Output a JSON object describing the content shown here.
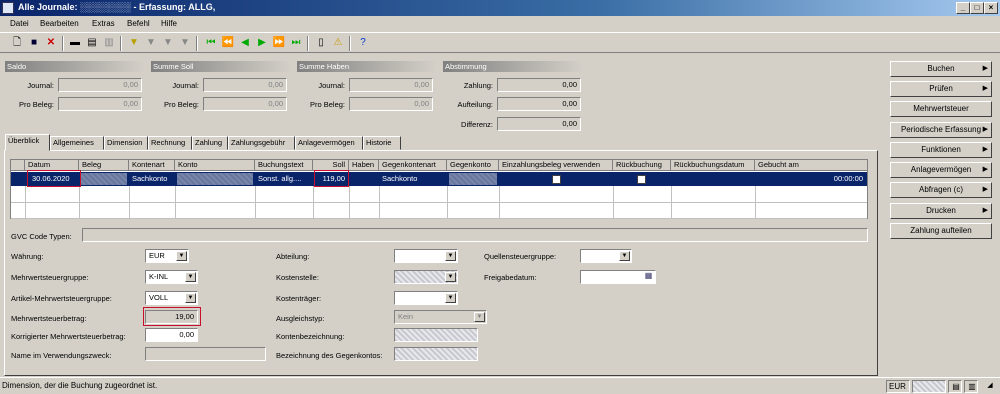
{
  "window": {
    "title": "Alle Journale: ░░░░░░░░ - Erfassung: ALLG,",
    "min": "_",
    "max": "□",
    "close": "×"
  },
  "menu": [
    "Datei",
    "Bearbeiten",
    "Extras",
    "Befehl",
    "Hilfe"
  ],
  "groups": {
    "saldo": "Saldo",
    "soll": "Summe Soll",
    "haben": "Summe Haben",
    "abstimmung": "Abstimmung"
  },
  "saldo": {
    "journal_label": "Journal:",
    "journal_value": "0,00",
    "probeleg_label": "Pro Beleg:",
    "probeleg_value": "0,00"
  },
  "soll": {
    "journal_label": "Journal:",
    "journal_value": "0,00",
    "probeleg_label": "Pro Beleg:",
    "probeleg_value": "0,00"
  },
  "haben": {
    "journal_label": "Journal:",
    "journal_value": "0,00",
    "probeleg_label": "Pro Beleg:",
    "probeleg_value": "0,00"
  },
  "abstimmung": {
    "zahlung_label": "Zahlung:",
    "zahlung_value": "0,00",
    "aufteilung_label": "Aufteilung:",
    "aufteilung_value": "0,00",
    "differenz_label": "Differenz:",
    "differenz_value": "0,00"
  },
  "tabs": [
    "Überblick",
    "Allgemeines",
    "Dimension",
    "Rechnung",
    "Zahlung",
    "Zahlungsgebühr",
    "Anlagevermögen",
    "Historie"
  ],
  "grid": {
    "columns": [
      "Datum",
      "Beleg",
      "Kontenart",
      "Konto",
      "Buchungstext",
      "Soll",
      "Haben",
      "Gegenkontenart",
      "Gegenkonto",
      "Einzahlungsbeleg verwenden",
      "Rückbuchung",
      "Rückbuchungsdatum",
      "Gebucht am"
    ],
    "row": {
      "datum": "30.06.2020",
      "kontenart": "Sachkonto",
      "buchungstext": "Sonst. allg....",
      "soll": "119,00",
      "gegenkontenart": "Sachkonto",
      "gebucht": "00:00:00"
    }
  },
  "gvc": {
    "label": "GVC Code Typen:"
  },
  "form": {
    "waehrung_label": "Währung:",
    "waehrung_value": "EUR",
    "mwstgruppe_label": "Mehrwertsteuergruppe:",
    "mwstgruppe_value": "K-INL",
    "artmwst_label": "Artikel-Mehrwertsteuergruppe:",
    "artmwst_value": "VOLL",
    "mwstbetrag_label": "Mehrwertsteuerbetrag:",
    "mwstbetrag_value": "19,00",
    "korr_label": "Korrigierter Mehrwertsteuerbetrag:",
    "korr_value": "0,00",
    "name_label": "Name im Verwendungszweck:",
    "abteilung_label": "Abteilung:",
    "kostenstelle_label": "Kostenstelle:",
    "kostentraeger_label": "Kostenträger:",
    "ausgleich_label": "Ausgleichstyp:",
    "ausgleich_value": "Kein",
    "kontenbez_label": "Kontenbezeichnung:",
    "gegenbez_label": "Bezeichnung des Gegenkontos:",
    "quellen_label": "Quellensteuergruppe:",
    "freigabe_label": "Freigabedatum:"
  },
  "buttons": [
    {
      "label": "Buchen",
      "arrow": "▶"
    },
    {
      "label": "Prüfen",
      "arrow": "▶"
    },
    {
      "label": "Mehrwertsteuer",
      "arrow": ""
    },
    {
      "label": "Periodische Erfassung",
      "arrow": "▶"
    },
    {
      "label": "Funktionen",
      "arrow": "▶"
    },
    {
      "label": "Anlagevermögen",
      "arrow": "▶"
    },
    {
      "label": "Abfragen (c)",
      "arrow": "▶"
    },
    {
      "label": "Drucken",
      "arrow": "▶"
    },
    {
      "label": "Zahlung aufteilen",
      "arrow": ""
    }
  ],
  "status": {
    "text": "Dimension, der die Buchung zugeordnet ist.",
    "currency": "EUR"
  },
  "colors": {
    "selection": "#0a246a",
    "highlight": "#c8102e"
  }
}
